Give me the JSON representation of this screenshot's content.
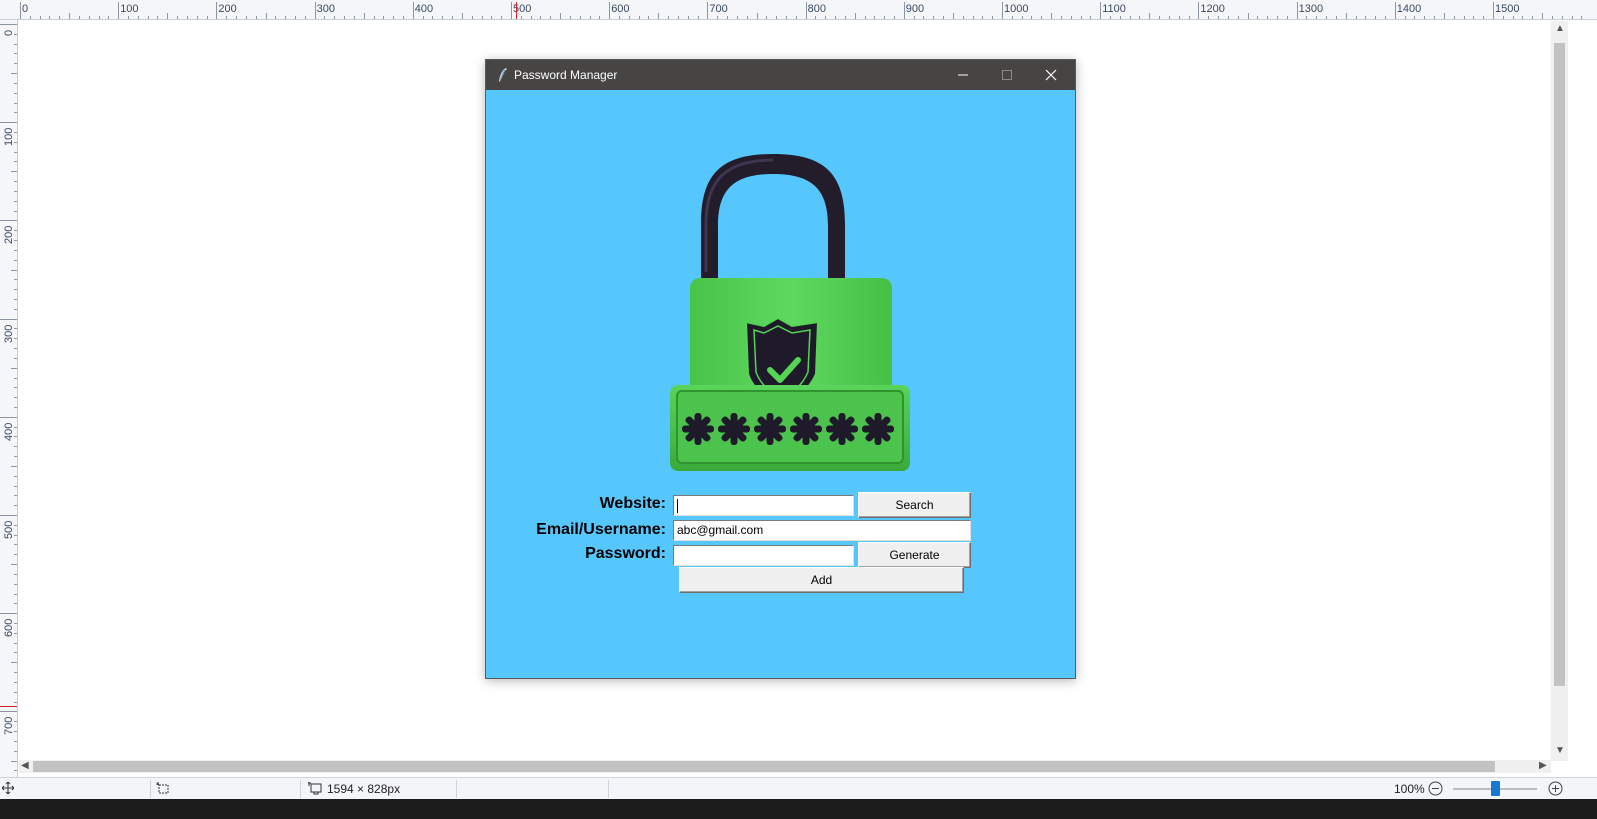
{
  "ruler": {
    "top_labels": [
      "0",
      "100",
      "200",
      "300",
      "400",
      "500",
      "600",
      "700",
      "800",
      "900",
      "1000",
      "1100",
      "1200",
      "1300",
      "1400",
      "1500"
    ],
    "left_labels": [
      "0",
      "100",
      "200",
      "300",
      "400",
      "500",
      "600",
      "700"
    ]
  },
  "window": {
    "title": "Password Manager",
    "minimize_glyph": "—",
    "maximize_glyph": "☐",
    "close_glyph": "✕"
  },
  "form": {
    "website_label": "Website:",
    "website_value": "",
    "email_label": "Email/Username:",
    "email_value": "abc@gmail.com",
    "password_label": "Password:",
    "password_value": "",
    "search_label": "Search",
    "generate_label": "Generate",
    "add_label": "Add"
  },
  "logo": {
    "shackle_color": "#221c2b",
    "body_color": "#52cf52",
    "dark_color": "#1e1a29",
    "mask_text": "******"
  },
  "statusbar": {
    "image_size": "1594 × 828px",
    "zoom": "100%",
    "zoom_level": 0.5
  },
  "colors": {
    "window_bg": "#55c7fd",
    "titlebar_bg": "#474544"
  }
}
